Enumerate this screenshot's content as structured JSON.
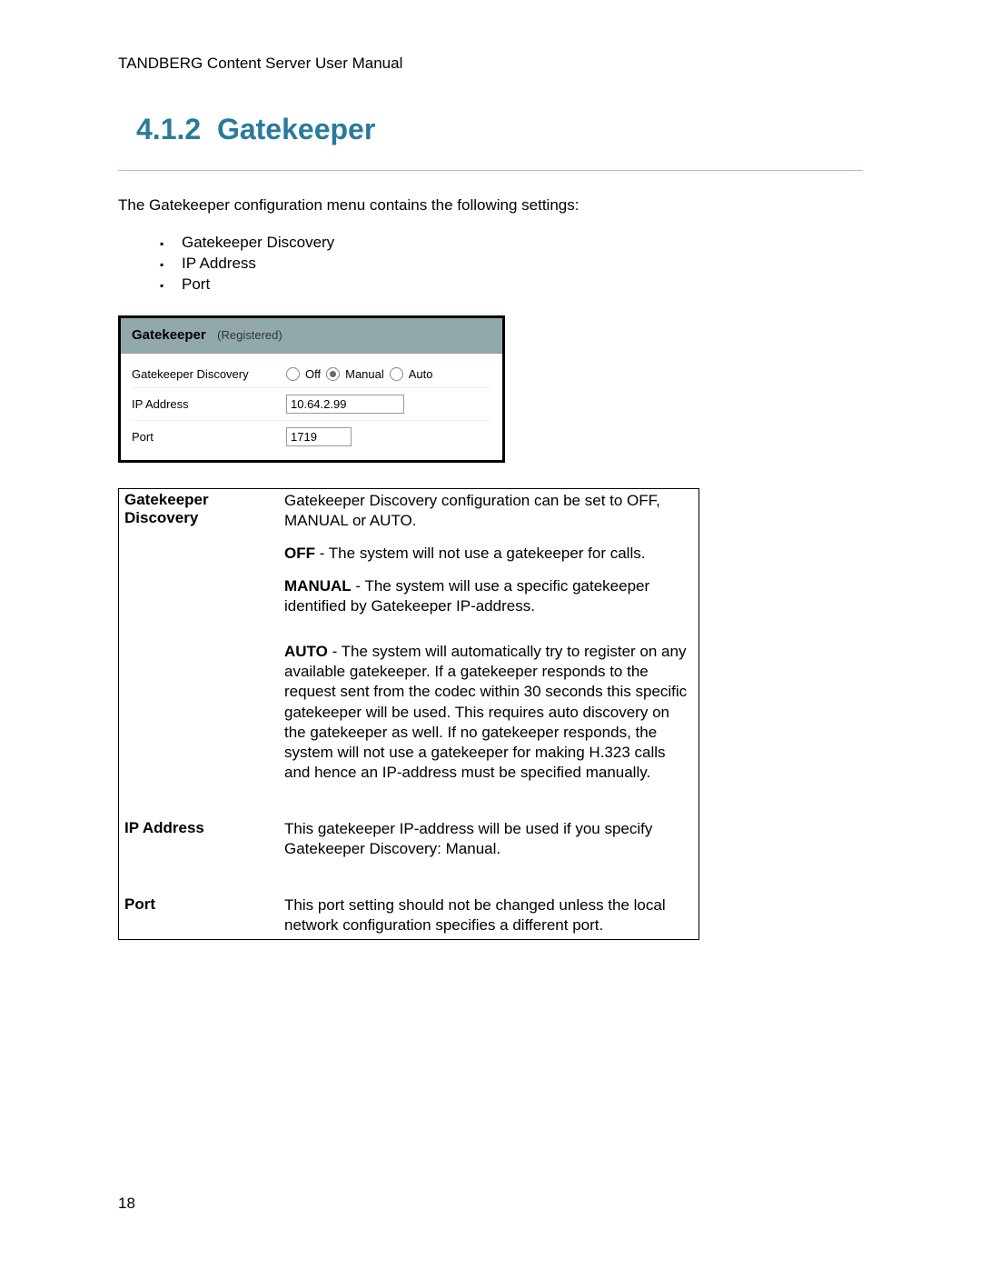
{
  "header": "TANDBERG Content Server User Manual",
  "section_number": "4.1.2",
  "section_title": "Gatekeeper",
  "intro": "The Gatekeeper configuration menu contains the following settings:",
  "settings_list": [
    "Gatekeeper Discovery",
    "IP Address",
    "Port"
  ],
  "ui": {
    "title": "Gatekeeper",
    "status": "(Registered)",
    "rows": {
      "discovery_label": "Gatekeeper Discovery",
      "radio_off": "Off",
      "radio_manual": "Manual",
      "radio_auto": "Auto",
      "ip_label": "IP Address",
      "ip_value": "10.64.2.99",
      "port_label": "Port",
      "port_value": "1719"
    }
  },
  "desc": {
    "gatekeeper_discovery": {
      "term": "Gatekeeper Discovery",
      "p1": "Gatekeeper Discovery configuration can be set to OFF, MANUAL or AUTO.",
      "p2a": "OFF",
      "p2b": " - The system will not use a gatekeeper for calls.",
      "p3a": "MANUAL",
      "p3b": " - The system will use a specific gatekeeper identified by Gatekeeper IP-address.",
      "p4a": "AUTO",
      "p4b": " - The system will automatically try to register on any available gatekeeper. If a gatekeeper responds to the request sent from the codec within 30 seconds this specific gatekeeper will be used. This requires auto discovery on the gatekeeper as well.  If no gatekeeper responds, the system will not use a gatekeeper for making H.323 calls and hence an IP-address must be specified manually."
    },
    "ip_address": {
      "term": "IP Address",
      "text": "This gatekeeper IP-address will be used if you specify Gatekeeper Discovery: Manual."
    },
    "port": {
      "term": "Port",
      "text": "This port setting should not be changed unless the local network configuration specifies a different port."
    }
  },
  "page_number": "18"
}
